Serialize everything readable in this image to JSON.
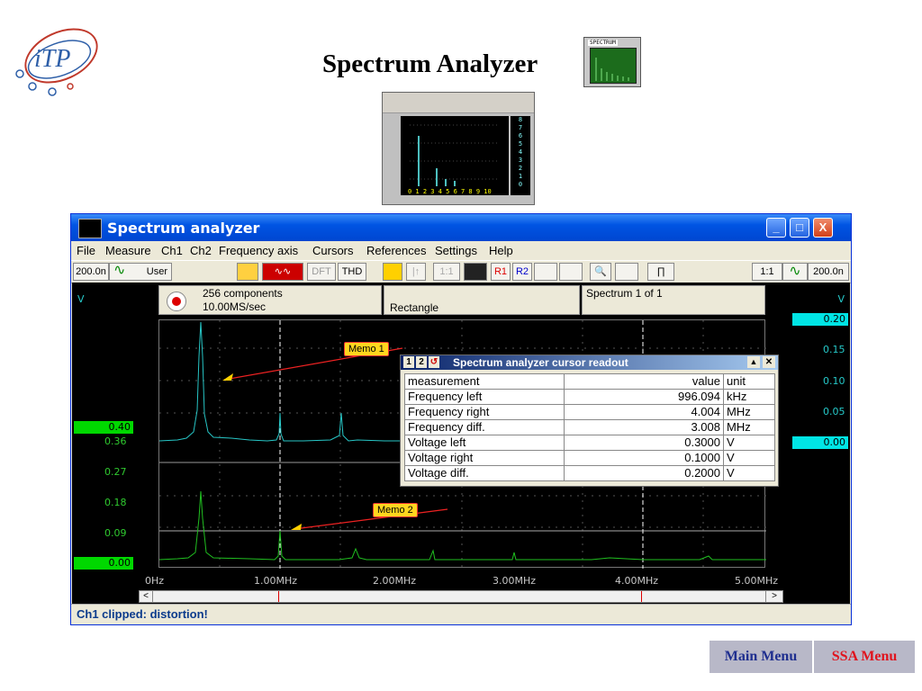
{
  "slide": {
    "title": "Spectrum Analyzer",
    "logo_text": "iTP",
    "spectrum_icon_label": "SPECTRUM"
  },
  "thumbnail": {
    "ticks": "0 1 2 3 4 5 6 7 8 9 10",
    "side_numbers": [
      "8",
      "7",
      "6",
      "5",
      "4",
      "3",
      "2",
      "1",
      "0"
    ]
  },
  "window": {
    "title": "Spectrum analyzer",
    "controls": {
      "minimize": "_",
      "maximize": "□",
      "close": "X"
    },
    "menu": [
      "File",
      "Measure",
      "Ch1",
      "Ch2",
      "Frequency axis",
      "Cursors",
      "References",
      "Settings",
      "Help"
    ],
    "toolbar": {
      "left_value": "200.0n",
      "left_mode": "User",
      "dft": "DFT",
      "thd": "THD",
      "r1": "R1",
      "r2": "R2",
      "ratio": "1:1",
      "right_value": "200.0n"
    },
    "info": {
      "components": "256 components",
      "rate": "10.00MS/sec",
      "window": "Rectangle",
      "spectrum": "Spectrum 1 of 1"
    },
    "axis_unit_left": "V",
    "axis_unit_right": "V",
    "ch1_right_labels": [
      "0.20",
      "0.15",
      "0.10",
      "0.05",
      "0.00"
    ],
    "ch2_left_labels": [
      "0.40",
      "0.36",
      "0.27",
      "0.18",
      "0.09",
      "0.00"
    ],
    "x_labels": [
      "0Hz",
      "1.00MHz",
      "2.00MHz",
      "3.00MHz",
      "4.00MHz",
      "5.00MHz"
    ],
    "scroll_left": "<",
    "scroll_right": ">",
    "memos": {
      "memo1": "Memo 1",
      "memo2": "Memo 2"
    },
    "status": "Ch1 clipped: distortion!"
  },
  "readout": {
    "title": "Spectrum analyzer cursor readout",
    "tabs": [
      "1",
      "2"
    ],
    "headers": [
      "measurement",
      "value",
      "unit"
    ],
    "rows": [
      {
        "m": "Frequency left",
        "v": "996.094",
        "u": "kHz"
      },
      {
        "m": "Frequency right",
        "v": "4.004",
        "u": "MHz"
      },
      {
        "m": "Frequency diff.",
        "v": "3.008",
        "u": "MHz"
      },
      {
        "m": "Voltage left",
        "v": "0.3000",
        "u": "V"
      },
      {
        "m": "Voltage right",
        "v": "0.1000",
        "u": "V"
      },
      {
        "m": "Voltage diff.",
        "v": "0.2000",
        "u": "V"
      }
    ]
  },
  "nav": {
    "main_menu": "Main Menu",
    "ssa_menu": "SSA Menu"
  },
  "colors": {
    "trace_ch1": "#27c6c6",
    "trace_ch2": "#20c020",
    "cursor": "#ffffff",
    "memo_bg": "#ffd61e",
    "titlebar": "#0054e3"
  }
}
